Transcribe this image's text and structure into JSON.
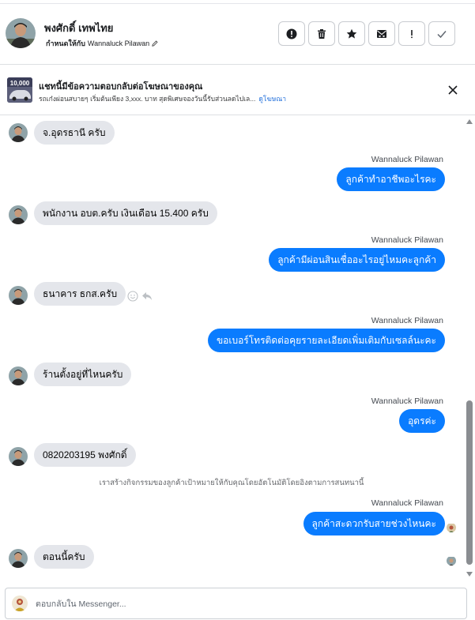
{
  "header": {
    "contact_name": "พงศักดิ์ เทพไทย",
    "assign_prefix": "กำหนดให้กับ",
    "assignee": "Wannaluck Pilawan",
    "actions": [
      {
        "name": "spam-button",
        "icon": "alert-circle-icon"
      },
      {
        "name": "delete-button",
        "icon": "trash-icon"
      },
      {
        "name": "star-button",
        "icon": "star-icon"
      },
      {
        "name": "archive-button",
        "icon": "envelope-x-icon"
      },
      {
        "name": "flag-button",
        "icon": "exclamation-icon"
      },
      {
        "name": "done-button",
        "icon": "check-icon"
      }
    ]
  },
  "ad": {
    "thumb_text": "10,000",
    "title": "แชทนี้มีข้อความตอบกลับต่อโฆษณาของคุณ",
    "subtitle": "รถเก๋งผ่อนสบายๆ เริ่มต้นเพียง 3,xxx. บาท สุดพิเศษจองวันนี้รับส่วนลดไปเล...",
    "link": "ดูโฆษณา"
  },
  "messages": {
    "m1": "จ.อุดรธานี ครับ",
    "s2": "Wannaluck Pilawan",
    "m2": "ลูกค้าทำอาชีพอะไรคะ",
    "m3": "พนักงาน อบต.ครับ เงินเดือน 15.400  ครับ",
    "s4": "Wannaluck Pilawan",
    "m4": "ลูกค้ามีผ่อนสินเชื่ออะไรอยู่ไหมคะลูกค้า",
    "m5": "ธนาคาร ธกส.ครับ",
    "s6": "Wannaluck Pilawan",
    "m6": "ขอเบอร์โทรติดต่อคุยรายละเอียดเพิ่มเติมกับเซลล์นะคะ",
    "m7": "ร้านตั้งอยู่ที่ไหนครับ",
    "s8": "Wannaluck Pilawan",
    "m8": "อุดรค่ะ",
    "m9": "0820203195 พงศักดิ์",
    "system": "เราสร้างกิจกรรมของลูกค้าเป้าหมายให้กับคุณโดยอัตโนมัติโดยอิงตามการสนทนานี้",
    "s10": "Wannaluck Pilawan",
    "m10": "ลูกค้าสะดวกรับสายช่วงไหนคะ",
    "m11": "ตอนนี้ครับ"
  },
  "composer": {
    "placeholder": "ตอบกลับใน Messenger..."
  },
  "colors": {
    "outgoing_bubble": "#0a7cff",
    "incoming_bubble": "#e4e6eb",
    "link": "#216fdb"
  }
}
